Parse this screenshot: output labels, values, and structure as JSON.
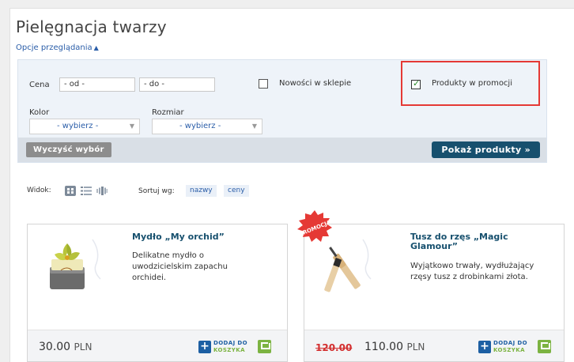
{
  "page": {
    "title": "Pielęgnacja twarzy",
    "view_options_label": "Opcje przeglądania"
  },
  "filters": {
    "price_label": "Cena",
    "price_from_value": "- od -",
    "price_to_value": "- do -",
    "new_in_store_label": "Nowości w sklepie",
    "new_in_store_checked": false,
    "promo_products_label": "Produkty w promocji",
    "promo_products_checked": true,
    "color_label": "Kolor",
    "color_selected": "- wybierz -",
    "size_label": "Rozmiar",
    "size_selected": "- wybierz -",
    "clear_button": "Wyczyść wybór",
    "show_button": "Pokaż produkty »"
  },
  "toolbar": {
    "view_label": "Widok:",
    "sort_label": "Sortuj wg:",
    "sort_options": [
      "nazwy",
      "ceny"
    ]
  },
  "products": [
    {
      "name": "Mydło „My orchid”",
      "description_lines": [
        "Delikatne mydło o",
        "uwodzicielskim zapachu",
        "orchidei."
      ],
      "price": "30.00",
      "currency": "PLN",
      "old_price": "",
      "promo": false
    },
    {
      "name_lines": [
        "Tusz do rzęs „Magic",
        "Glamour”"
      ],
      "description_lines": [
        "Wyjątkowo trwały, wydłużający",
        "rzęsy tusz z drobinkami złota."
      ],
      "price": "110.00",
      "currency": "PLN",
      "old_price": "120.00",
      "promo": true,
      "badge_text": "PROMOCJA"
    }
  ],
  "cart_button": {
    "line1": "DODAJ DO",
    "line2": "KOSZYKA"
  },
  "colors": {
    "accent_blue": "#17506e",
    "link_blue": "#2a5da8",
    "promo_red": "#d32f2f",
    "highlight_red": "#e53935",
    "cart_green": "#7cb342"
  },
  "icons": {
    "view_grid": "grid-view-icon",
    "view_list": "list-view-icon",
    "view_carousel": "carousel-view-icon",
    "check": "checkmark-icon",
    "dropdown": "chevron-down-icon",
    "expand": "triangle-up-icon"
  }
}
